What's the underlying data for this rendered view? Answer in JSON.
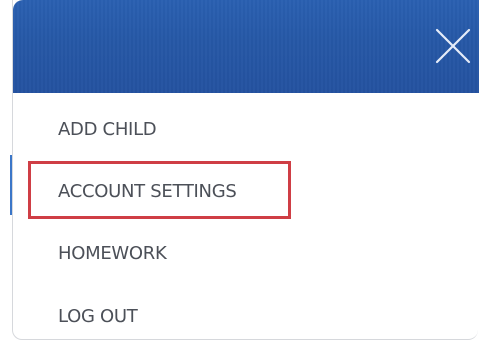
{
  "header": {
    "close_icon": "close-icon",
    "close_label": "Close menu",
    "background_color": "#2658a6"
  },
  "menu": {
    "items": [
      {
        "label": "ADD CHILD",
        "icon": ""
      },
      {
        "label": "ACCOUNT SETTINGS",
        "icon": "",
        "highlighted": true
      },
      {
        "label": "HOMEWORK",
        "icon": ""
      },
      {
        "label": "LOG OUT",
        "icon": ""
      }
    ]
  },
  "colors": {
    "text": "#4c5058",
    "highlight_border": "#cf3e45",
    "active_indicator": "#3b76c8"
  }
}
